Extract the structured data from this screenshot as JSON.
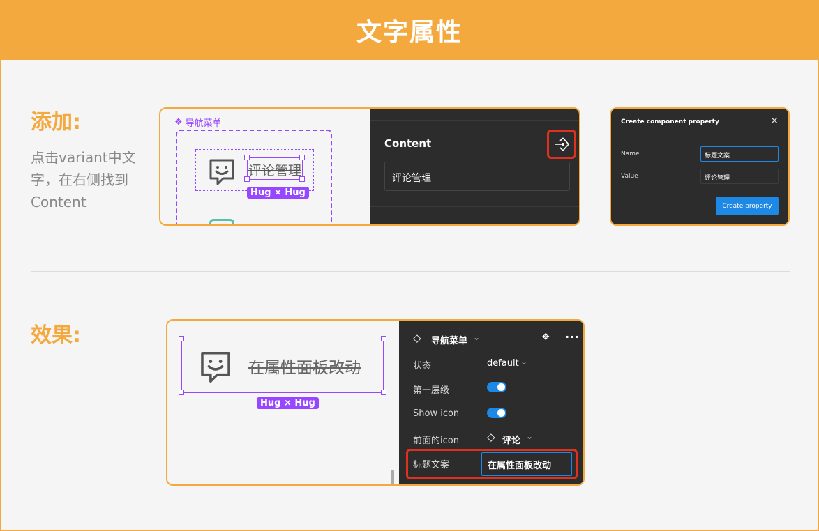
{
  "header": {
    "title": "文字属性"
  },
  "section1": {
    "title": "添加:",
    "description": "点击variant中文字，在右侧找到Content"
  },
  "canvas1": {
    "frame_label": "导航菜单",
    "text": "评论管理",
    "hug_badge": "Hug × Hug"
  },
  "content_panel": {
    "title": "Content",
    "value": "评论管理"
  },
  "dialog": {
    "title": "Create component property",
    "name_label": "Name",
    "name_value": "标题文案",
    "value_label": "Value",
    "value_value": "评论管理",
    "create_button": "Create property"
  },
  "section2": {
    "title": "效果:"
  },
  "canvas2": {
    "text": "在属性面板改动",
    "hug_badge": "Hug × Hug"
  },
  "props_panel": {
    "component_name": "导航菜单",
    "rows": {
      "state_label": "状态",
      "state_value": "default",
      "first_level_label": "第一层级",
      "show_icon_label": "Show icon",
      "front_icon_label": "前面的icon",
      "front_icon_value": "评论",
      "title_text_label": "标题文案",
      "title_text_value": "在属性面板改动"
    }
  },
  "colors": {
    "accent": "#f4a93f",
    "selection": "#9747ff",
    "highlight_red": "#e0301e",
    "toggle_blue": "#1e88e5",
    "panel_dark": "#2c2c2c"
  }
}
